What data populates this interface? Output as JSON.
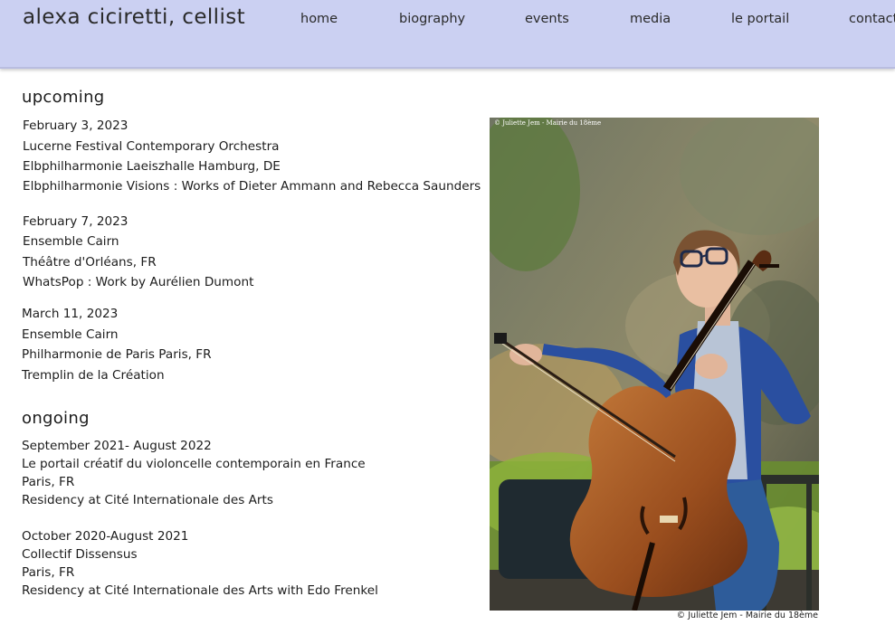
{
  "header": {
    "site_title": "alexa ciciretti, cellist",
    "nav": [
      "home",
      "biography",
      "events",
      "media",
      "le portail",
      "contact"
    ]
  },
  "upcoming": {
    "heading": "upcoming",
    "events": [
      {
        "date": "February 3, 2023",
        "lines": [
          "Lucerne Festival Contemporary Orchestra",
          "Elbphilharmonie Laeiszhalle Hamburg, DE",
          "Elbphilharmonie Visions : Works of Dieter Ammann and Rebecca Saunders"
        ]
      },
      {
        "date": "February 7, 2023",
        "lines": [
          "Ensemble Cairn",
          "Théâtre d'Orléans, FR",
          "WhatsPop : Work by Aurélien Dumont"
        ]
      },
      {
        "date": "March 11, 2023",
        "lines": [
          "Ensemble Cairn",
          "Philharmonie de Paris Paris, FR",
          "Tremplin de la Création"
        ]
      }
    ]
  },
  "ongoing": {
    "heading": "ongoing",
    "events": [
      {
        "date": "September 2021- August 2022",
        "lines": [
          "Le portail créatif du violoncelle contemporain en France",
          "Paris, FR",
          "Residency at Cité Internationale des Arts"
        ]
      },
      {
        "date": "October 2020-August 2021",
        "lines": [
          "Collectif Dissensus",
          "Paris, FR",
          "Residency at Cité Internationale des Arts with Edo Frenkel"
        ]
      }
    ]
  },
  "photo": {
    "overlay_credit": "© Juliette Jem - Mairie du 18ème",
    "caption": "© Juliette Jem - Mairie du 18ème"
  }
}
